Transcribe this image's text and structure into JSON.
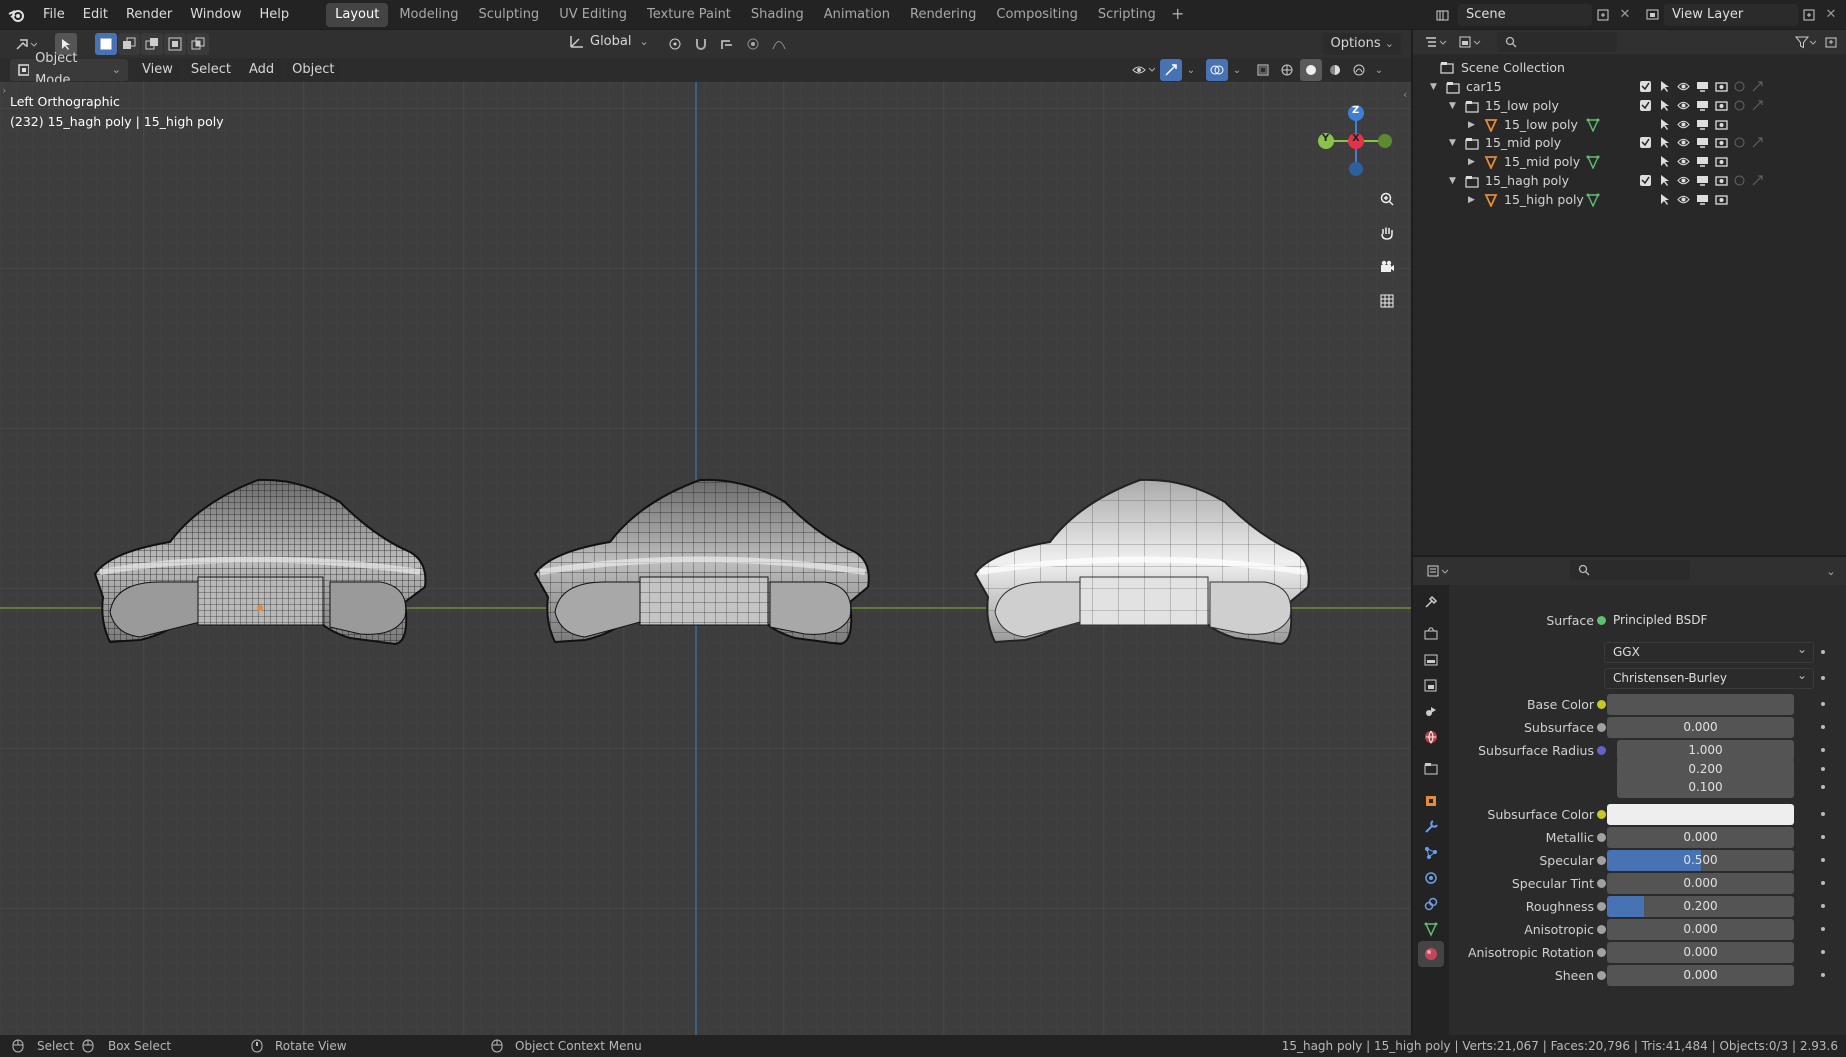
{
  "menubar": {
    "items": [
      "File",
      "Edit",
      "Render",
      "Window",
      "Help"
    ],
    "workspaces": [
      "Layout",
      "Modeling",
      "Sculpting",
      "UV Editing",
      "Texture Paint",
      "Shading",
      "Animation",
      "Rendering",
      "Compositing",
      "Scripting"
    ],
    "active_workspace": "Layout",
    "scene": "Scene",
    "view_layer": "View Layer"
  },
  "viewport_header": {
    "orientation": "Global",
    "options": "Options",
    "mode": "Object Mode",
    "menus": [
      "View",
      "Select",
      "Add",
      "Object"
    ]
  },
  "viewport": {
    "view_name": "Left Orthographic",
    "object_info": "(232) 15_hagh poly | 15_high poly",
    "gizmo_axes": {
      "z": "Z",
      "y": "Y",
      "x": "X"
    }
  },
  "outliner": {
    "root": "Scene Collection",
    "rows": [
      {
        "label": "car15",
        "kind": "collection",
        "depth": 1
      },
      {
        "label": "15_low poly",
        "kind": "collection",
        "depth": 2
      },
      {
        "label": "15_low poly",
        "kind": "object",
        "depth": 3
      },
      {
        "label": "15_mid poly",
        "kind": "collection",
        "depth": 2
      },
      {
        "label": "15_mid poly",
        "kind": "object",
        "depth": 3
      },
      {
        "label": "15_hagh poly",
        "kind": "collection",
        "depth": 2
      },
      {
        "label": "15_high poly",
        "kind": "object",
        "depth": 3
      }
    ]
  },
  "properties": {
    "surface_label": "Surface",
    "surface_value": "Principled BSDF",
    "distribution": "GGX",
    "subsurface_method": "Christensen-Burley",
    "fields": [
      {
        "label": "Base Color",
        "value": "",
        "fraction": 0,
        "socket": "#c7c729",
        "type": "color",
        "color": "#545454"
      },
      {
        "label": "Subsurface",
        "value": "0.000",
        "fraction": 0,
        "socket": "#a1a1a1",
        "type": "number"
      },
      {
        "label": "Subsurface Radius",
        "value": "1.000",
        "fraction": 0,
        "socket": "#6363c7",
        "type": "vector"
      },
      {
        "label": "",
        "value": "0.200",
        "fraction": 0,
        "socket": "",
        "type": "vector"
      },
      {
        "label": "",
        "value": "0.100",
        "fraction": 0,
        "socket": "",
        "type": "vector"
      },
      {
        "label": "Subsurface Color",
        "value": "",
        "fraction": 0,
        "socket": "#c7c729",
        "type": "color",
        "color": "#eeeeee"
      },
      {
        "label": "Metallic",
        "value": "0.000",
        "fraction": 0,
        "socket": "#a1a1a1",
        "type": "number"
      },
      {
        "label": "Specular",
        "value": "0.500",
        "fraction": 0.5,
        "socket": "#a1a1a1",
        "type": "number"
      },
      {
        "label": "Specular Tint",
        "value": "0.000",
        "fraction": 0,
        "socket": "#a1a1a1",
        "type": "number"
      },
      {
        "label": "Roughness",
        "value": "0.200",
        "fraction": 0.2,
        "socket": "#a1a1a1",
        "type": "number"
      },
      {
        "label": "Anisotropic",
        "value": "0.000",
        "fraction": 0,
        "socket": "#a1a1a1",
        "type": "number"
      },
      {
        "label": "Anisotropic Rotation",
        "value": "0.000",
        "fraction": 0,
        "socket": "#a1a1a1",
        "type": "number"
      },
      {
        "label": "Sheen",
        "value": "0.000",
        "fraction": 0,
        "socket": "#a1a1a1",
        "type": "number"
      }
    ]
  },
  "statusbar": {
    "select": "Select",
    "box_select": "Box Select",
    "rotate": "Rotate View",
    "context": "Object Context Menu",
    "stats": "15_hagh poly | 15_high poly | Verts:21,067 | Faces:20,796 | Tris:41,484 | Objects:0/3 | 2.93.6"
  },
  "colors": {
    "accent": "#4772b3",
    "x_axis": "#e3334a",
    "y_axis": "#8bc34a",
    "z_axis": "#3f7fd6",
    "object_icon": "#e38b3a",
    "mesh_icon": "#5fbf6f"
  }
}
